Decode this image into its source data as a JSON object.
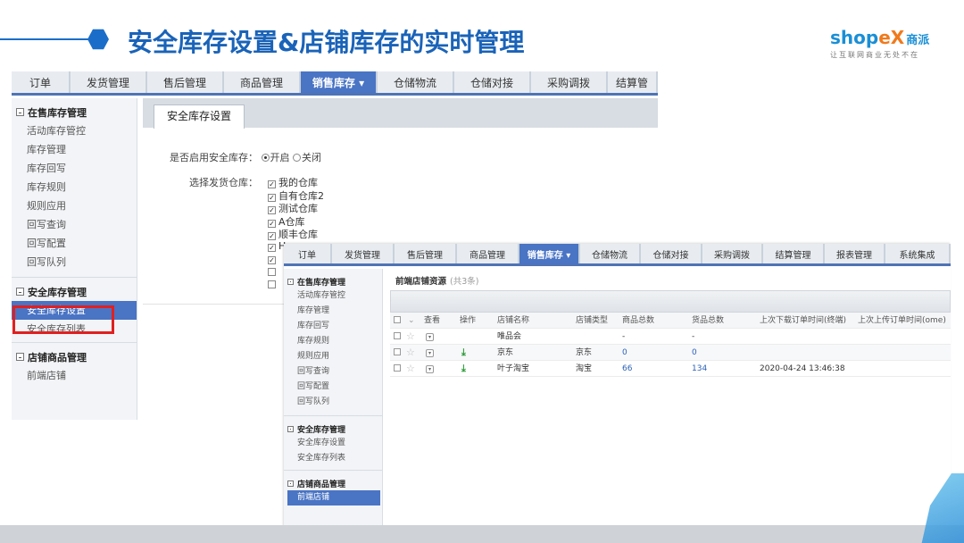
{
  "slide": {
    "title": "安全库存设置&店铺库存的实时管理"
  },
  "logo": {
    "word_a": "shop",
    "word_x": "eX",
    "cn": "商派",
    "slogan": "让互联网商业无处不在"
  },
  "nav": {
    "tabs": [
      "订单",
      "发货管理",
      "售后管理",
      "商品管理",
      "销售库存",
      "仓储物流",
      "仓储对接",
      "采购调拨",
      "结算管理",
      "报表管理",
      "系统集成"
    ],
    "active_index": 4,
    "back_tabs": [
      "订单",
      "发货管理",
      "售后管理",
      "商品管理",
      "销售库存 ▾",
      "仓储物流",
      "仓储对接",
      "采购调拨",
      "结算管"
    ],
    "front_tabs": [
      "订单",
      "发货管理",
      "售后管理",
      "商品管理",
      "销售库存 ▾",
      "仓储物流",
      "仓储对接",
      "采购调拨",
      "结算管理",
      "报表管理",
      "系统集成"
    ]
  },
  "sidebar": {
    "group1_title": "在售库存管理",
    "group1_items": [
      "活动库存管控",
      "库存管理",
      "库存回写",
      "库存规则",
      "规则应用",
      "回写查询",
      "回写配置",
      "回写队列"
    ],
    "group2_title": "安全库存管理",
    "group2_items": [
      "安全库存设置",
      "安全库存列表"
    ],
    "group3_title": "店铺商品管理",
    "group3_items": [
      "前端店铺"
    ]
  },
  "back_panel": {
    "subtab": "安全库存设置",
    "enable_label": "是否启用安全库存：",
    "radio_on": "开启",
    "radio_off": "关闭",
    "warehouse_label": "选择发货仓库：",
    "warehouses": [
      {
        "name": "我的仓库",
        "checked": true
      },
      {
        "name": "自有仓库2",
        "checked": true
      },
      {
        "name": "测试仓库",
        "checked": true
      },
      {
        "name": "A仓库",
        "checked": true
      },
      {
        "name": "顺丰仓库",
        "checked": true
      },
      {
        "name": "H",
        "checked": true
      },
      {
        "name": "",
        "checked": true
      },
      {
        "name": "",
        "checked": false
      },
      {
        "name": "",
        "checked": false
      }
    ]
  },
  "front_panel": {
    "title": "前端店铺资源",
    "count": "(共3条)",
    "columns": [
      "查看",
      "操作",
      "店铺名称",
      "店铺类型",
      "商品总数",
      "货品总数",
      "上次下载订单时间(终端)",
      "上次上传订单时间(ome)"
    ],
    "rows": [
      {
        "name": "唯品会",
        "type": "",
        "goods": "-",
        "products": "-",
        "last_download": "",
        "has_download": false
      },
      {
        "name": "京东",
        "type": "京东",
        "goods": "0",
        "products": "0",
        "last_download": "",
        "has_download": true
      },
      {
        "name": "叶子淘宝",
        "type": "淘宝",
        "goods": "66",
        "products": "134",
        "last_download": "2020-04-24 13:46:38",
        "has_download": true
      }
    ]
  },
  "colors": {
    "title_blue": "#1a63b8",
    "nav_active": "#4a74c4",
    "highlight_red": "#e02020",
    "link_blue": "#2b61b8"
  }
}
